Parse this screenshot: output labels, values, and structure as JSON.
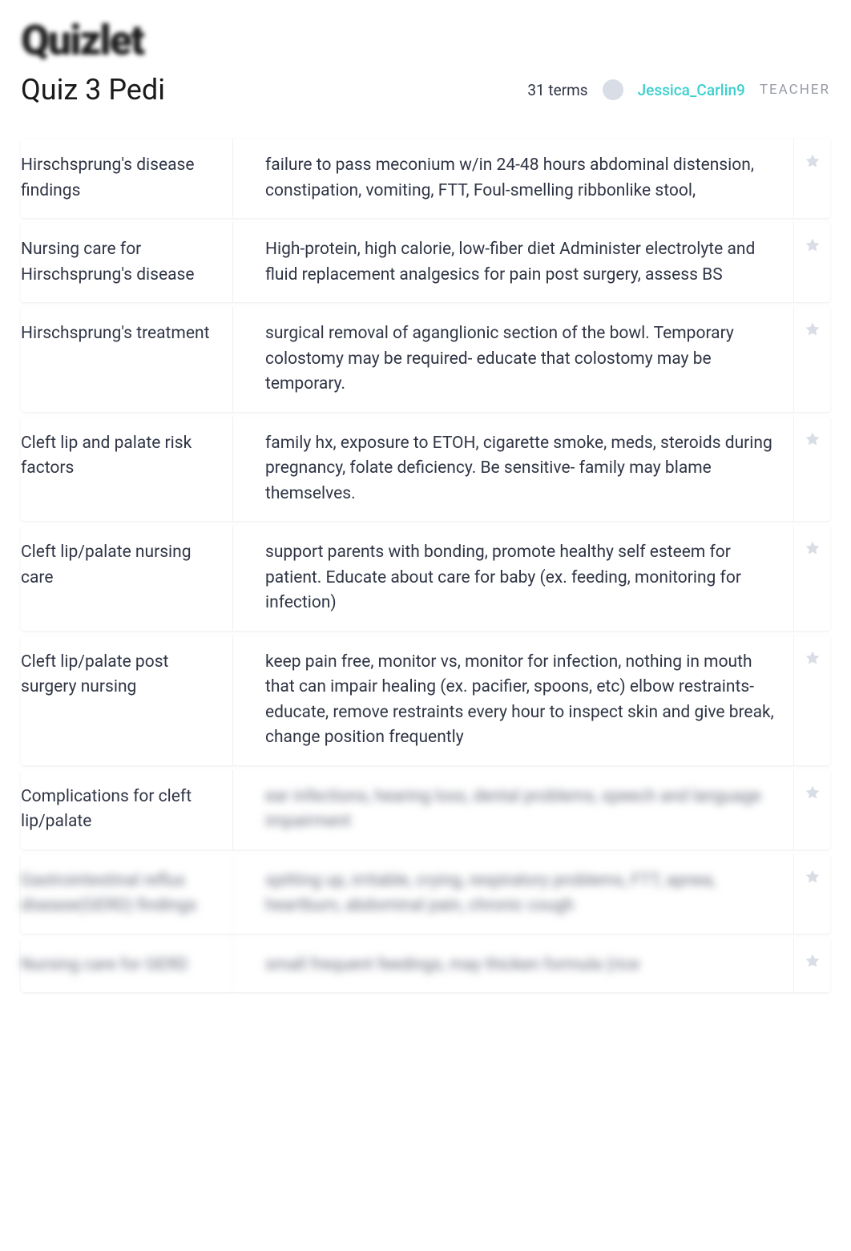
{
  "logo": "Quizlet",
  "title": "Quiz 3 Pedi",
  "term_count": "31 terms",
  "author": "Jessica_Carlin9",
  "role": "TEACHER",
  "cards": [
    {
      "term": "Hirschsprung's disease findings",
      "def": "failure to pass meconium w/in 24-48 hours abdominal distension, constipation, vomiting, FTT, Foul-smelling ribbonlike stool,",
      "blurred": false
    },
    {
      "term": "Nursing care for Hirschsprung's disease",
      "def": "High-protein, high calorie, low-fiber diet Administer electrolyte and fluid replacement analgesics for pain post surgery, assess BS",
      "blurred": false
    },
    {
      "term": "Hirschsprung's treatment",
      "def": "surgical removal of aganglionic section of the bowl. Temporary colostomy may be required- educate that colostomy may be temporary.",
      "blurred": false
    },
    {
      "term": "Cleft lip and palate risk factors",
      "def": "family hx, exposure to ETOH, cigarette smoke, meds, steroids during pregnancy, folate deficiency. Be sensitive- family may blame themselves.",
      "blurred": false
    },
    {
      "term": "Cleft lip/palate nursing care",
      "def": "support parents with bonding, promote healthy self esteem for patient. Educate about care for baby (ex. feeding, monitoring for infection)",
      "blurred": false
    },
    {
      "term": "Cleft lip/palate post surgery nursing",
      "def": "keep pain free, monitor vs, monitor for infection, nothing in mouth that can impair healing (ex. pacifier, spoons, etc) elbow restraints- educate, remove restraints every hour to inspect skin and give break, change position frequently",
      "blurred": false
    },
    {
      "term": "Complications for cleft lip/palate",
      "def": "ear infections, hearing loss, dental problems, speech and language impairment",
      "blurred_def": true
    },
    {
      "term": "Gastrointestinal reflux disease(GERD) findings",
      "def": "spitting up, irritable, crying, respiratory problems, FTT, apnea, heartburn, abdominal pain, chronic cough",
      "blurred": true
    },
    {
      "term": "Nursing care for GERD",
      "def": "small frequent feedings, may thicken formula (rice",
      "blurred": true
    }
  ]
}
